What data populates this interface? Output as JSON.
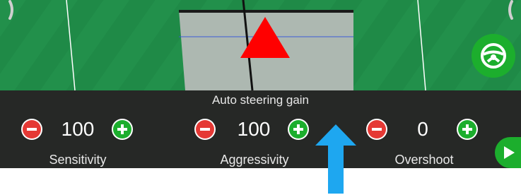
{
  "gain_panel": {
    "title": "Auto steering gain",
    "controls": [
      {
        "label": "Sensitivity",
        "value": "100"
      },
      {
        "label": "Aggressivity",
        "value": "100"
      },
      {
        "label": "Overshoot",
        "value": "0"
      }
    ]
  },
  "icons": {
    "steering_wheel": "steering-wheel-icon",
    "play": "play-icon",
    "vehicle_marker": "triangle-marker",
    "minus": "minus-icon",
    "plus": "plus-icon"
  },
  "colors": {
    "field_green": "#1f8a47",
    "accent_green": "#1cae2d",
    "minus_red": "#e53935",
    "vehicle_red": "#ff0000",
    "annotation_blue": "#1ea7f0"
  }
}
